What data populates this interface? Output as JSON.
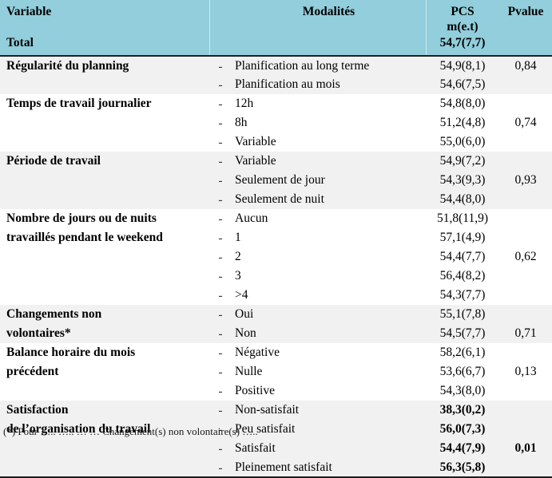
{
  "table": {
    "header": {
      "variable": "Variable",
      "modalites": "Modalités",
      "pcs_line1": "PCS",
      "pcs_line2": "m(e.t)",
      "pvalue": "Pvalue",
      "total_label": "Total",
      "total_value": "54,7(7,7)"
    },
    "columns": [
      "Variable",
      "Modalités",
      "PCS m(e.t)",
      "Pvalue"
    ],
    "dash": "-",
    "groups": [
      {
        "variable_lines": [
          "Régularité du planning"
        ],
        "pvalue": "0,84",
        "pvalue_row": 0,
        "shaded": true,
        "bold_values": false,
        "rows": [
          {
            "modalite": "Planification au long terme",
            "pcs": "54,9(8,1)"
          },
          {
            "modalite": "Planification au mois",
            "pcs": "54,6(7,5)"
          }
        ]
      },
      {
        "variable_lines": [
          "Temps de travail journalier"
        ],
        "pvalue": "0,74",
        "pvalue_row": 1,
        "shaded": false,
        "bold_values": false,
        "rows": [
          {
            "modalite": "12h",
            "pcs": "54,8(8,0)"
          },
          {
            "modalite": "8h",
            "pcs": "51,2(4,8)"
          },
          {
            "modalite": "Variable",
            "pcs": "55,0(6,0)"
          }
        ]
      },
      {
        "variable_lines": [
          "Période de travail"
        ],
        "pvalue": "0,93",
        "pvalue_row": 1,
        "shaded": true,
        "bold_values": false,
        "rows": [
          {
            "modalite": "Variable",
            "pcs": "54,9(7,2)"
          },
          {
            "modalite": "Seulement de jour",
            "pcs": "54,3(9,3)"
          },
          {
            "modalite": "Seulement de nuit",
            "pcs": "54,4(8,0)"
          }
        ]
      },
      {
        "variable_lines": [
          "Nombre de jours ou de nuits",
          "travaillés pendant le weekend"
        ],
        "pvalue": "0,62",
        "pvalue_row": 2,
        "shaded": false,
        "bold_values": false,
        "rows": [
          {
            "modalite": "Aucun",
            "pcs": "51,8(11,9)"
          },
          {
            "modalite": "1",
            "pcs": "57,1(4,9)"
          },
          {
            "modalite": "2",
            "pcs": "54,4(7,7)"
          },
          {
            "modalite": "3",
            "pcs": "56,4(8,2)"
          },
          {
            "modalite": ">4",
            "pcs": "54,3(7,7)"
          }
        ]
      },
      {
        "variable_lines": [
          "Changements non",
          "volontaires*"
        ],
        "pvalue": "0,71",
        "pvalue_row": 1,
        "shaded": true,
        "bold_values": false,
        "rows": [
          {
            "modalite": "Oui",
            "pcs": "55,1(7,8)"
          },
          {
            "modalite": "Non",
            "pcs": "54,5(7,7)"
          }
        ]
      },
      {
        "variable_lines": [
          "Balance horaire du mois",
          "précédent"
        ],
        "pvalue": "0,13",
        "pvalue_row": 1,
        "shaded": false,
        "bold_values": false,
        "rows": [
          {
            "modalite": "Négative",
            "pcs": "58,2(6,1)"
          },
          {
            "modalite": "Nulle",
            "pcs": "53,6(6,7)"
          },
          {
            "modalite": "Positive",
            "pcs": "54,3(8,0)"
          }
        ]
      },
      {
        "variable_lines": [
          "Satisfaction",
          "de l’organisation du travail"
        ],
        "pvalue": "0,01",
        "pvalue_row": 2,
        "shaded": true,
        "bold_values": true,
        "rows": [
          {
            "modalite": "Non-satisfait",
            "pcs": "38,3(0,2)"
          },
          {
            "modalite": "Peu satisfait",
            "pcs": "56,0(7,3)"
          },
          {
            "modalite": "Satisfait",
            "pcs": "54,4(7,9)"
          },
          {
            "modalite": "Pleinement satisfait",
            "pcs": "56,3(5,8)"
          }
        ]
      }
    ]
  },
  "footnote": "(*) Pour ….. …..  … …  Changement(s) non volontaire(s) ….."
}
